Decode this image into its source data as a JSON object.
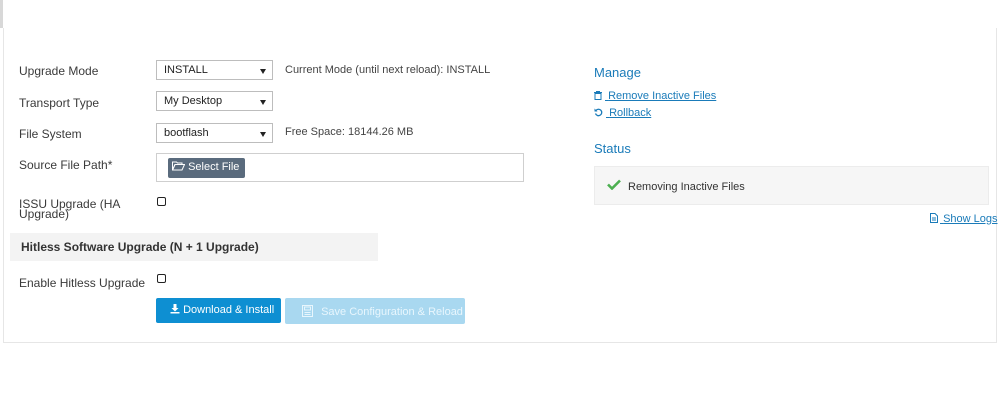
{
  "form": {
    "upgrade_mode": {
      "label": "Upgrade Mode",
      "value": "INSTALL",
      "note": "Current Mode (until next reload): INSTALL"
    },
    "transport_type": {
      "label": "Transport Type",
      "value": "My Desktop"
    },
    "file_system": {
      "label": "File System",
      "value": "bootflash",
      "note": "Free Space: 18144.26 MB"
    },
    "source_file_path": {
      "label": "Source File Path*",
      "button": "Select File"
    },
    "issu_upgrade": {
      "label_line1": "ISSU Upgrade (HA",
      "label_line2": "Upgrade)",
      "checked": false
    }
  },
  "hitless": {
    "section_title": "Hitless Software Upgrade (N + 1 Upgrade)",
    "enable_label": "Enable Hitless Upgrade",
    "checked": false
  },
  "actions": {
    "download_install": "Download & Install",
    "save_reload": "Save Configuration & Reload"
  },
  "manage": {
    "title": "Manage",
    "remove_inactive": "Remove Inactive Files",
    "rollback": "Rollback"
  },
  "status": {
    "title": "Status",
    "message": "Removing Inactive Files",
    "show_logs": "Show Logs"
  },
  "colors": {
    "accent": "#0e8fd2",
    "link": "#1a7bb9",
    "success": "#4caf50"
  }
}
